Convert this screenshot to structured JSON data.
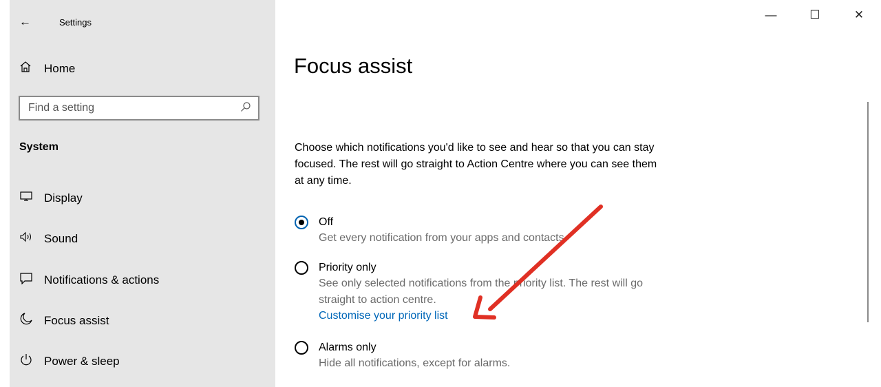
{
  "window": {
    "title": "Settings",
    "controls": {
      "minimize_icon": "minimize-icon",
      "maximize_icon": "maximize-icon",
      "close_icon": "close-icon"
    }
  },
  "sidebar": {
    "home_label": "Home",
    "search_placeholder": "Find a setting",
    "section_title": "System",
    "items": [
      {
        "label": "Display",
        "icon": "monitor-icon"
      },
      {
        "label": "Sound",
        "icon": "speaker-icon"
      },
      {
        "label": "Notifications & actions",
        "icon": "notification-icon"
      },
      {
        "label": "Focus assist",
        "icon": "moon-icon"
      },
      {
        "label": "Power & sleep",
        "icon": "power-icon"
      }
    ]
  },
  "main": {
    "title": "Focus assist",
    "description": "Choose which notifications you'd like to see and hear so that you can stay focused. The rest will go straight to Action Centre where you can see them at any time.",
    "options": [
      {
        "label": "Off",
        "description": "Get every notification from your apps and contacts.",
        "selected": true
      },
      {
        "label": "Priority only",
        "description": "See only selected notifications from the priority list. The rest will go straight to action centre.",
        "link": "Customise your priority list",
        "selected": false
      },
      {
        "label": "Alarms only",
        "description": "Hide all notifications, except for alarms.",
        "selected": false
      }
    ]
  },
  "annotation": {
    "color": "#e03024"
  }
}
